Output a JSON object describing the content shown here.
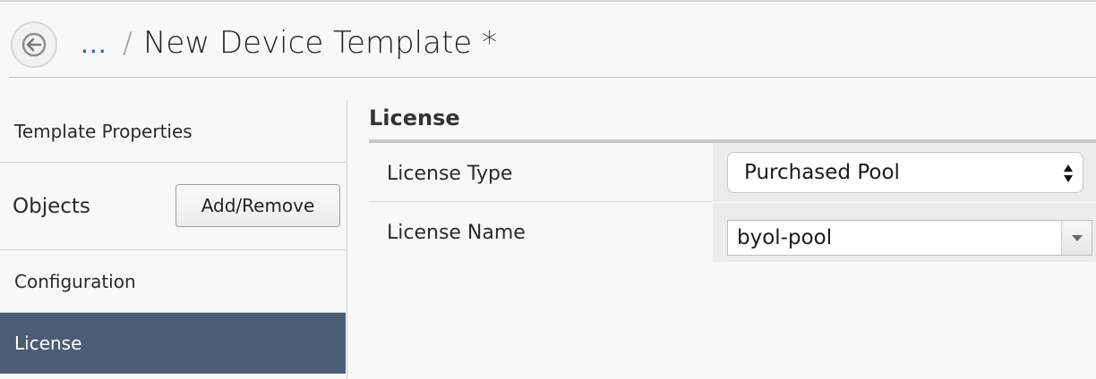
{
  "header": {
    "breadcrumb_ellipsis": "...",
    "breadcrumb_separator": "/",
    "title": "New Device Template *"
  },
  "sidebar": {
    "items": [
      {
        "label": "Template Properties"
      },
      {
        "label": "Objects",
        "button_label": "Add/Remove"
      },
      {
        "label": "Configuration"
      },
      {
        "label": "License",
        "selected": true
      }
    ]
  },
  "main": {
    "section_title": "License",
    "fields": [
      {
        "label": "License Type",
        "value": "Purchased Pool",
        "control": "select",
        "icon": "up-down-arrows-icon"
      },
      {
        "label": "License Name",
        "value": "byol-pool",
        "control": "combobox",
        "icon": "dropdown-arrow-icon"
      }
    ]
  },
  "colors": {
    "selected_nav_bg": "#4a5d74",
    "breadcrumb_link": "#2c5d8f"
  },
  "icons": {
    "back": "back-arrow-icon"
  }
}
